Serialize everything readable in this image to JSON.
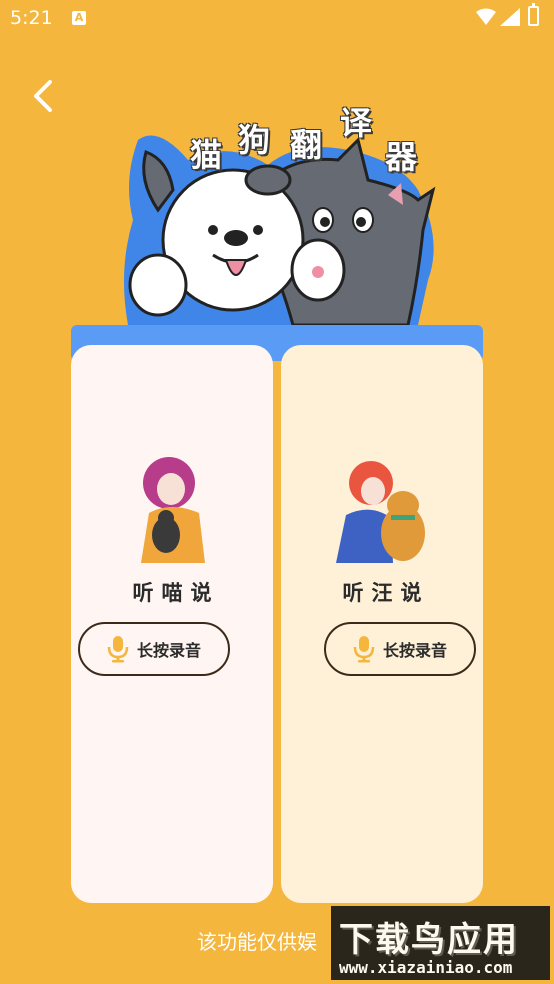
{
  "status_bar": {
    "time": "5:21",
    "notification_icon": "a-icon"
  },
  "header": {
    "title_chars": [
      "猫",
      "狗",
      "翻",
      "译",
      "器"
    ]
  },
  "cards": [
    {
      "label": "听喵说",
      "button_label": "长按录音",
      "illustration": "girl-with-cat"
    },
    {
      "label": "听汪说",
      "button_label": "长按录音",
      "illustration": "girl-with-dog"
    }
  ],
  "disclaimer": "该功能仅供娱",
  "watermark": {
    "main": "下载鸟应用",
    "url": "www.xiazainiao.com"
  },
  "colors": {
    "background": "#F4B63D",
    "bar": "#5A9BF6",
    "cat_card": "#FFF5F2",
    "dog_card": "#FEF1D7",
    "mic": "#F4B63D"
  }
}
